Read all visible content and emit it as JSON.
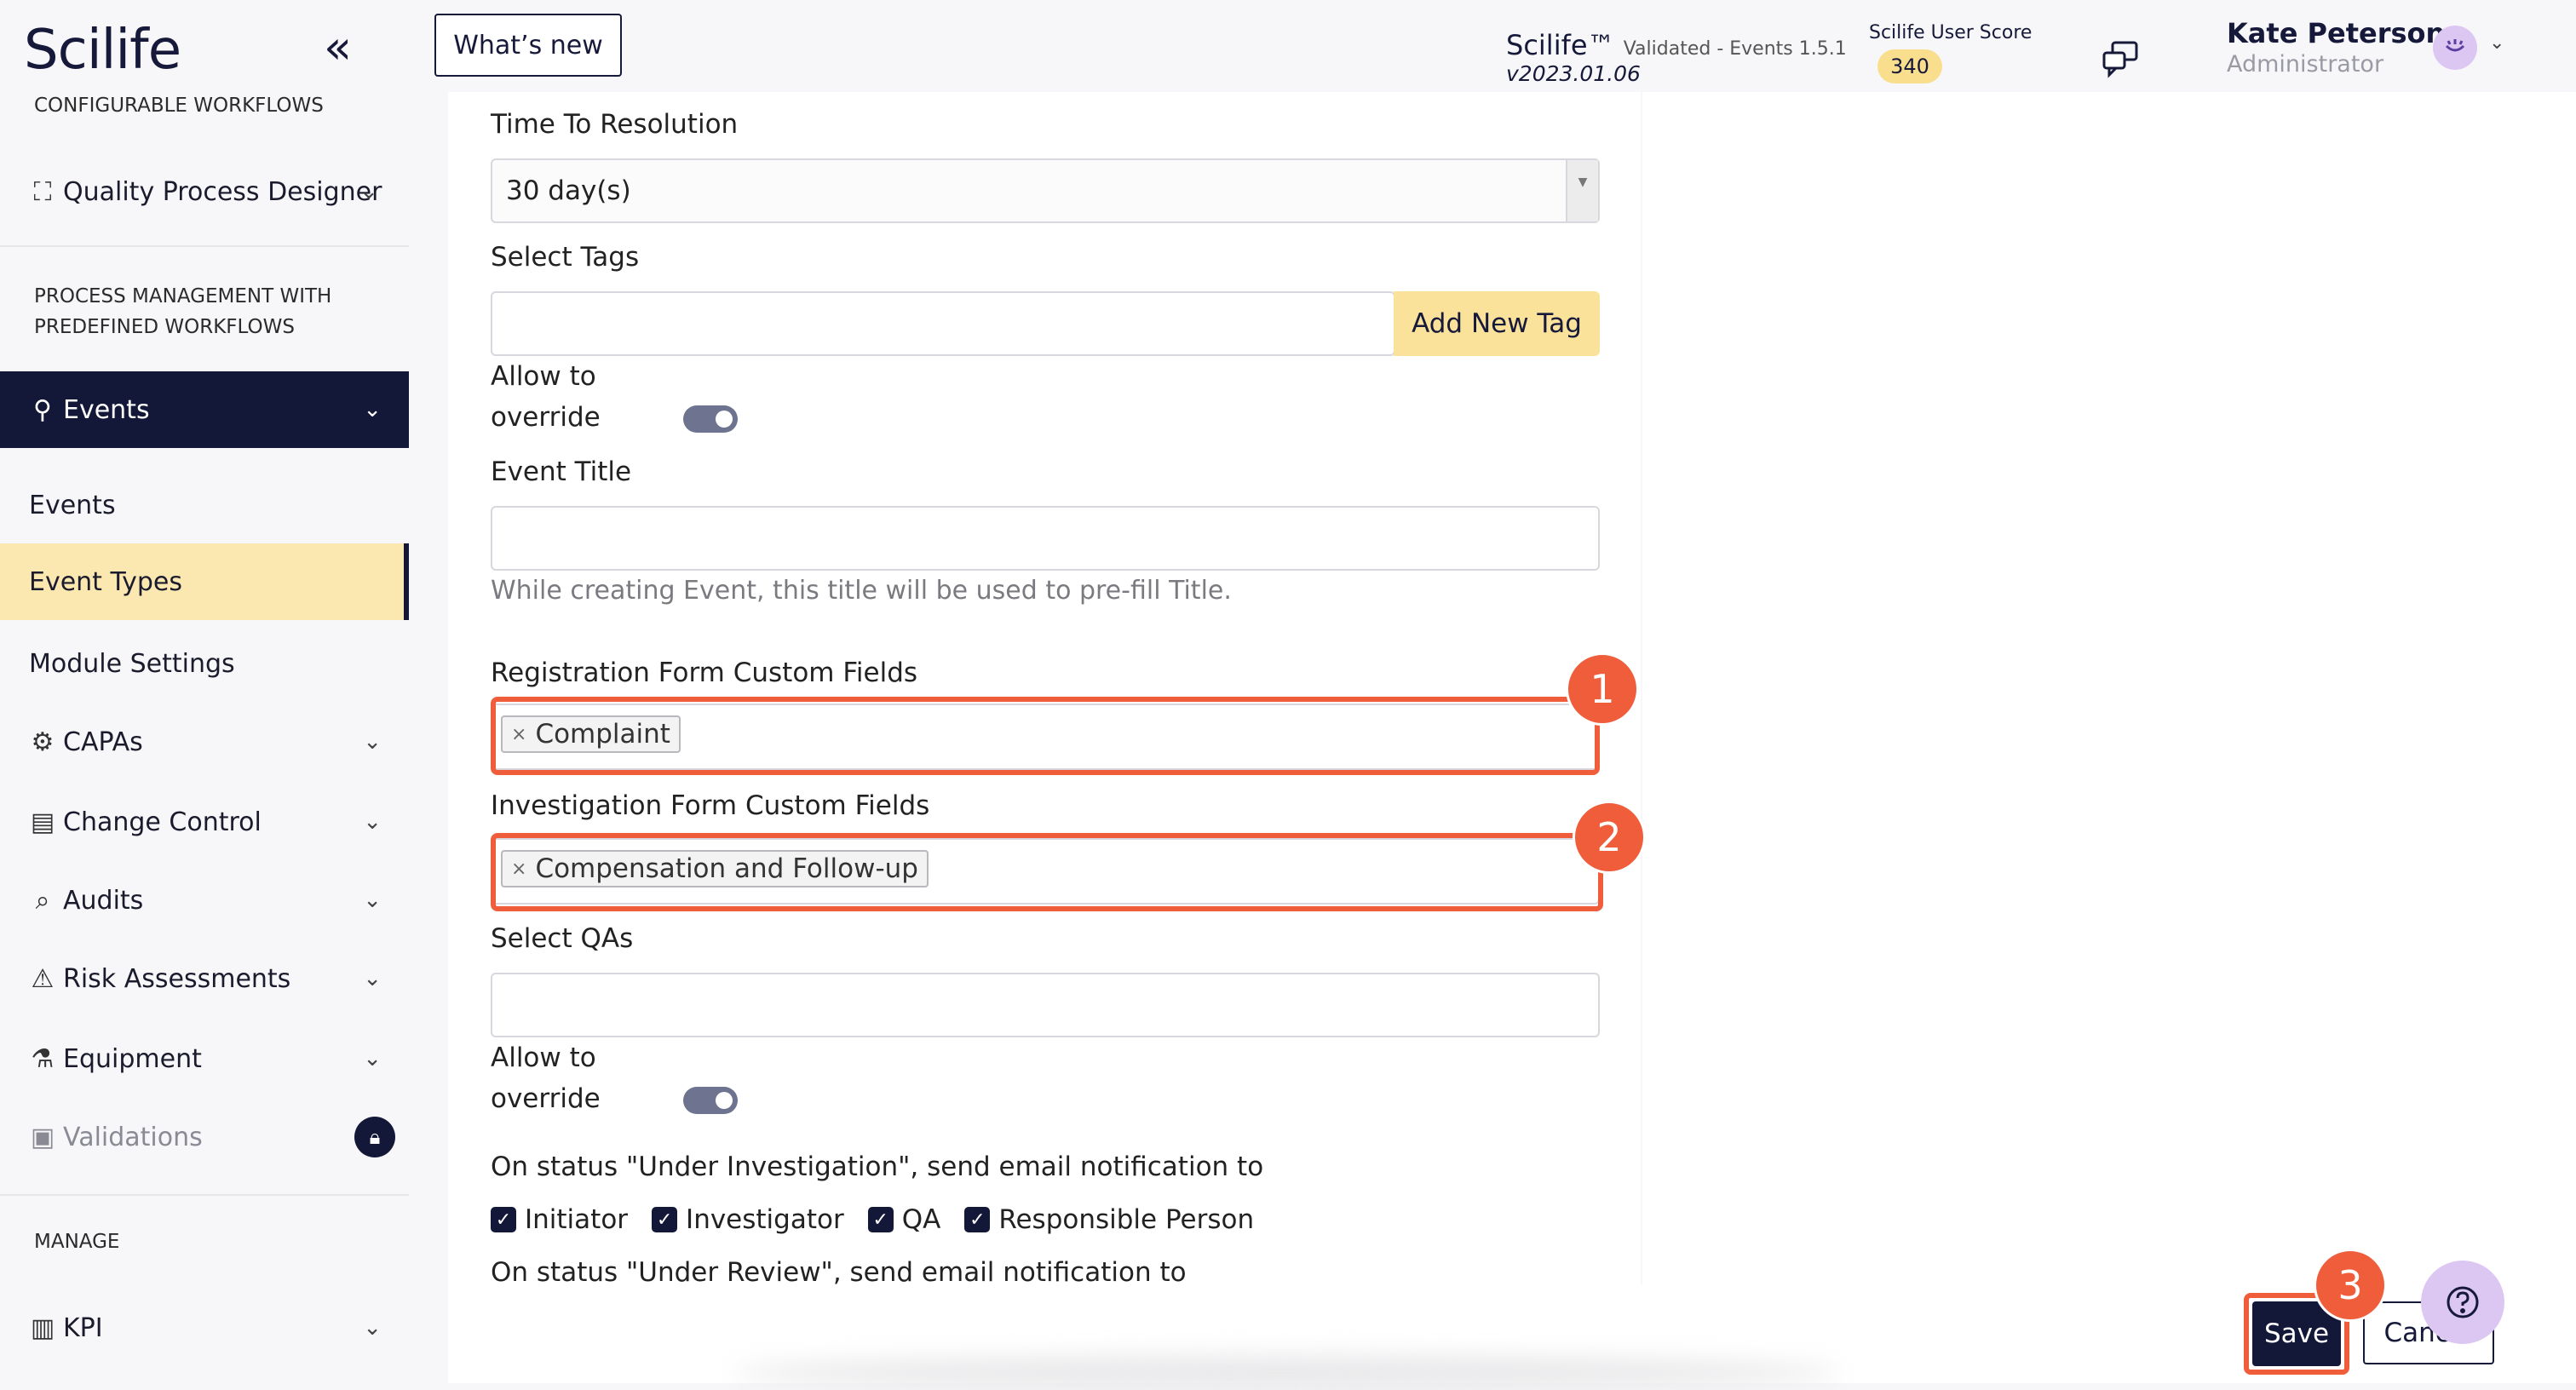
{
  "sidebar": {
    "logo": "Scilife",
    "collapse_icon": "double-chevron-left-icon",
    "section_configurable": "CONFIGURABLE WORKFLOWS",
    "quality_process_designer": "Quality Process Designer",
    "section_process_line1": "PROCESS MANAGEMENT WITH",
    "section_process_line2": "PREDEFINED WORKFLOWS",
    "events_group": "Events",
    "events_sub": "Events",
    "event_types": "Event Types",
    "module_settings": "Module Settings",
    "capas": "CAPAs",
    "change_control": "Change Control",
    "audits": "Audits",
    "risk_assessments": "Risk Assessments",
    "equipment": "Equipment",
    "validations": "Validations",
    "section_manage": "MANAGE",
    "kpi": "KPI"
  },
  "header": {
    "whats_new": "What’s new",
    "app_name": "Scilife™",
    "app_version": "Validated - Events 1.5.1",
    "app_build": "v2023.01.06",
    "score_label": "Scilife User Score",
    "score_value": "340",
    "user_name": "Kate Peterson",
    "user_role": "Administrator"
  },
  "form": {
    "time_to_resolution_label": "Time To Resolution",
    "time_to_resolution_value": "30 day(s)",
    "select_tags_label": "Select Tags",
    "add_new_tag": "Add New Tag",
    "allow_override_line1": "Allow to",
    "allow_override_line2": "override",
    "event_title_label": "Event Title",
    "event_title_hint": "While creating Event, this title will be used to pre-fill Title.",
    "registration_label": "Registration Form Custom Fields",
    "registration_tag": "Complaint",
    "investigation_label": "Investigation Form Custom Fields",
    "investigation_tag": "Compensation and Follow-up",
    "select_qas_label": "Select QAs",
    "status_investigation_label": "On status \"Under Investigation\", send email notification to",
    "status_review_label": "On status \"Under Review\", send email notification to",
    "checkboxes": [
      "Initiator",
      "Investigator",
      "QA",
      "Responsible Person"
    ]
  },
  "annotations": {
    "badge1": "1",
    "badge2": "2",
    "badge3": "3"
  },
  "actions": {
    "save": "Save",
    "cancel": "Cancel"
  },
  "colors": {
    "primary": "#131838",
    "highlight": "#f05d3b",
    "accent_yellow": "#f9de8e",
    "active_bg": "#fbe7b0"
  }
}
